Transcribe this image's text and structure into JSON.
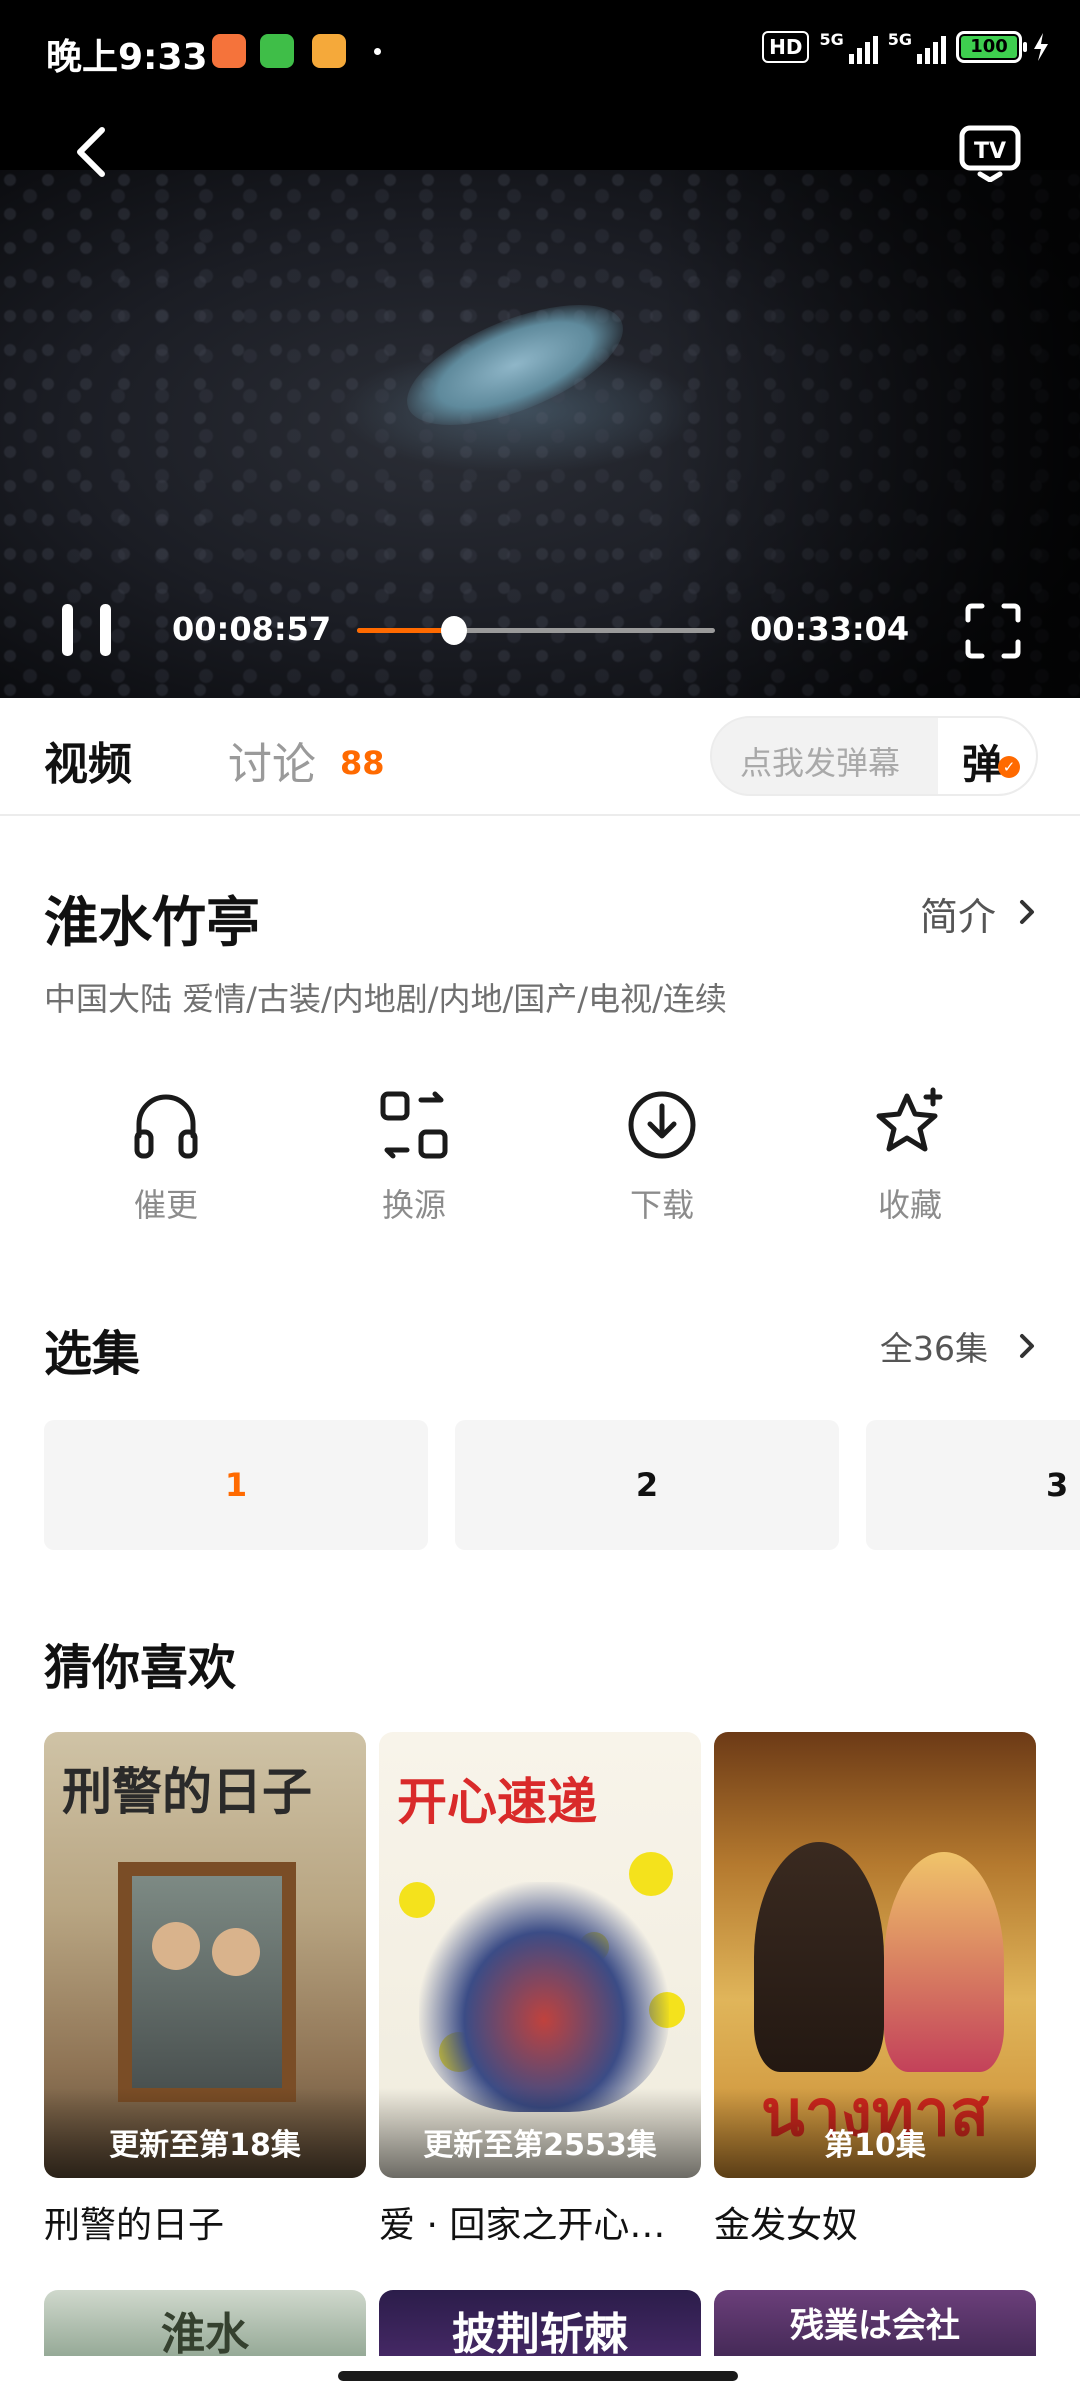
{
  "status_bar": {
    "time": "晚上9:33",
    "hd": "HD",
    "net1": "5G",
    "net2": "5G",
    "battery": "100",
    "app_icon_colors": [
      "#f5733b",
      "#3fbe48",
      "#f5a93a"
    ]
  },
  "player": {
    "current_time": "00:08:57",
    "total_time": "00:33:04",
    "progress_fraction": 0.271,
    "accent": "#ff6a00"
  },
  "tabs": {
    "video": "视频",
    "discuss": "讨论",
    "discuss_count": "88",
    "danmu_placeholder": "点我发弹幕",
    "danmu_button": "弹"
  },
  "show": {
    "title": "淮水竹亭",
    "intro_link": "简介",
    "meta": "中国大陆  爱情/古装/内地剧/内地/国产/电视/连续"
  },
  "actions": [
    {
      "label": "催更",
      "icon": "headphones-icon"
    },
    {
      "label": "换源",
      "icon": "switch-source-icon"
    },
    {
      "label": "下载",
      "icon": "download-icon"
    },
    {
      "label": "收藏",
      "icon": "star-plus-icon"
    }
  ],
  "episodes": {
    "section_title": "选集",
    "all_label": "全36集",
    "items": [
      "1",
      "2",
      "3"
    ],
    "active_index": 0
  },
  "recommend": {
    "section_title": "猜你喜欢",
    "cards": [
      {
        "name": "刑警的日子",
        "poster_caption": "更新至第18集",
        "poster_title": "刑警的日子"
      },
      {
        "name": "爱 · 回家之开心速递",
        "poster_caption": "更新至第2553集",
        "poster_title": "开心速递"
      },
      {
        "name": "金发女奴",
        "poster_caption": "第10集",
        "poster_title": "นางทาส"
      }
    ],
    "row2_titles": [
      "淮水",
      "披荆斩棘",
      "残業は会社"
    ]
  }
}
